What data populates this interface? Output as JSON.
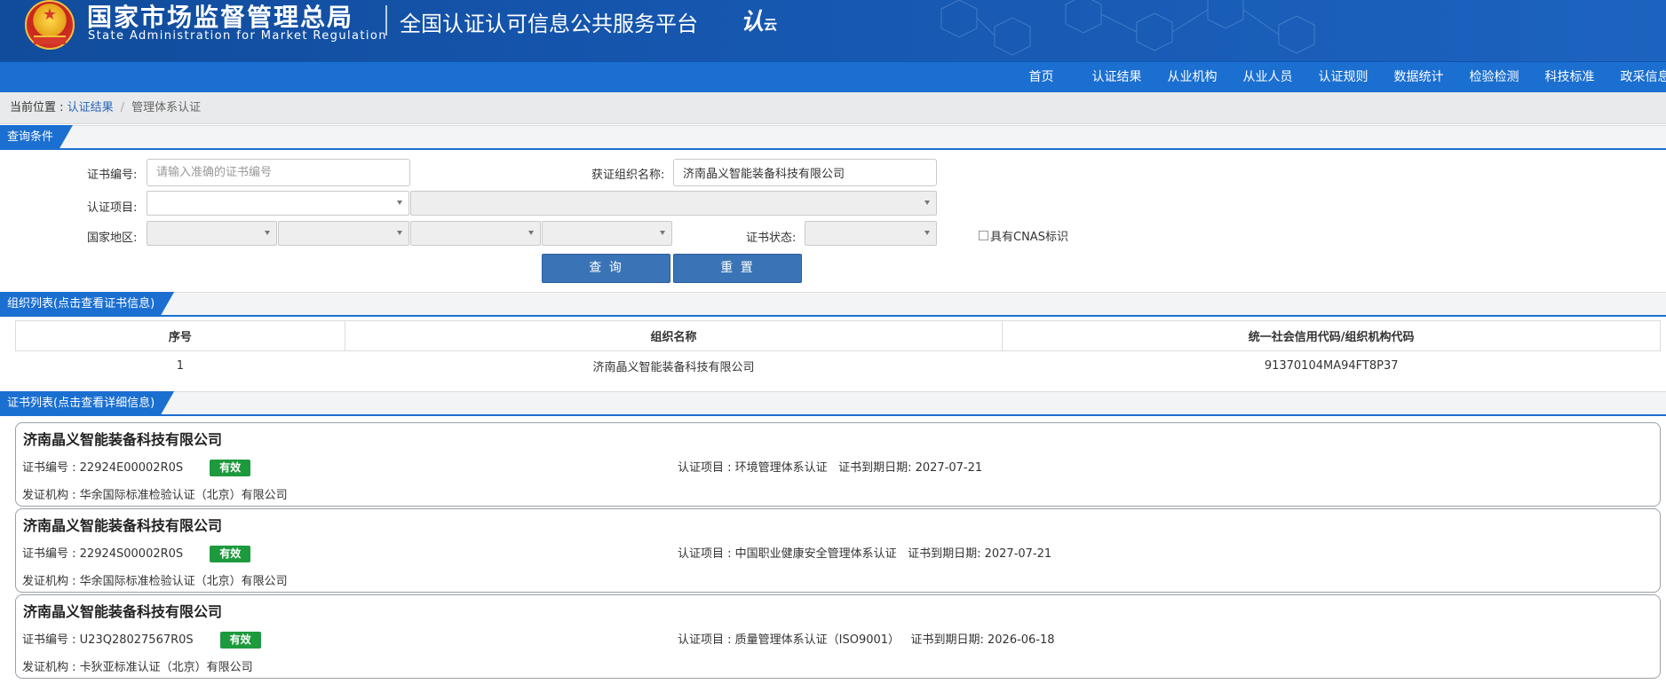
{
  "header": {
    "org_cn": "国家市场监督管理总局",
    "org_en": "State Administration for Market Regulation",
    "platform": "全国认证认可信息公共服务平台",
    "logo_text": "认",
    "logo_sub": "云",
    "brand_color": "#1657b0"
  },
  "nav": {
    "items": [
      "首页",
      "认证结果",
      "从业机构",
      "从业人员",
      "认证规则",
      "数据统计",
      "检验检测",
      "科技标准",
      "政采信息"
    ]
  },
  "breadcrumb": {
    "label": "当前位置 :",
    "link": "认证结果",
    "separator": "/",
    "current": "管理体系认证"
  },
  "query": {
    "section_title": "查询条件",
    "cert_no_label": "证书编号:",
    "cert_no_placeholder": "请输入准确的证书编号",
    "org_label": "获证组织名称:",
    "org_value": "济南晶义智能装备科技有限公司",
    "item_label": "认证项目:",
    "region_label": "国家地区:",
    "status_label": "证书状态:",
    "cnas_label": "具有CNAS标识",
    "search_button": "查 询",
    "reset_button": "重 置"
  },
  "org_list": {
    "section_title": "组织列表(点击查看证书信息)",
    "columns": [
      "序号",
      "组织名称",
      "统一社会信用代码/组织机构代码"
    ],
    "rows": [
      [
        "1",
        "济南晶义智能装备科技有限公司",
        "91370104MA94FT8P37"
      ]
    ]
  },
  "cert_list": {
    "section_title": "证书列表(点击查看详细信息)",
    "cert_no_prefix": "证书编号 :",
    "issuer_prefix": "发证机构 :",
    "item_prefix": "认证项目 :",
    "expiry_prefix": "证书到期日期:",
    "cards": [
      {
        "org": "济南晶义智能装备科技有限公司",
        "cert_no": "22924E00002R0S",
        "status": "有效",
        "item": "环境管理体系认证",
        "expiry": "2027-07-21",
        "issuer": "华余国际标准检验认证（北京）有限公司"
      },
      {
        "org": "济南晶义智能装备科技有限公司",
        "cert_no": "22924S00002R0S",
        "status": "有效",
        "item": "中国职业健康安全管理体系认证",
        "expiry": "2027-07-21",
        "issuer": "华余国际标准检验认证（北京）有限公司"
      },
      {
        "org": "济南晶义智能装备科技有限公司",
        "cert_no": "U23Q28027567R0S",
        "status": "有效",
        "item": "质量管理体系认证（ISO9001）",
        "expiry": "2026-06-18",
        "issuer": "卡狄亚标准认证（北京）有限公司"
      }
    ],
    "status_color": "#1e9a3e"
  }
}
